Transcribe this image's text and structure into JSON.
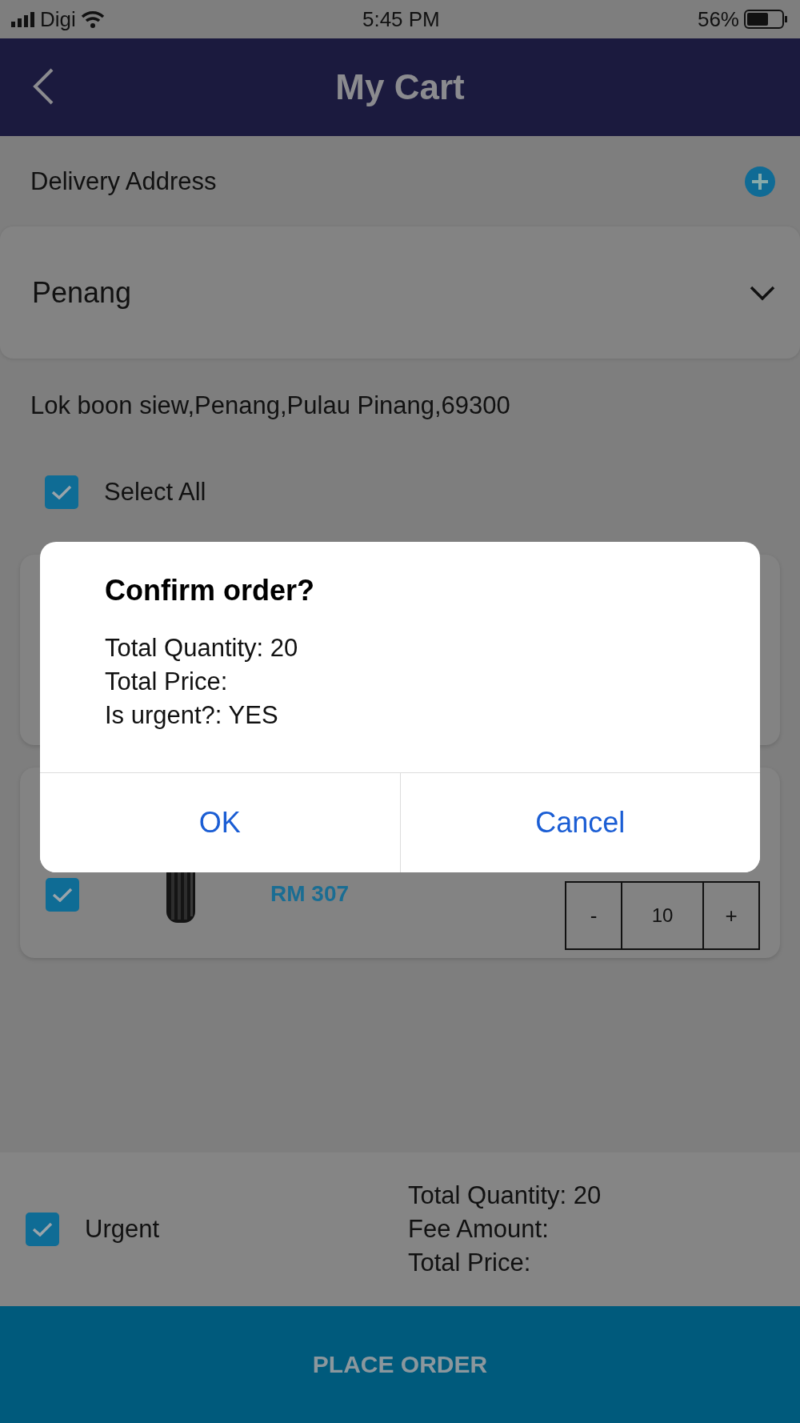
{
  "status_bar": {
    "carrier": "Digi",
    "time": "5:45 PM",
    "battery": "56%"
  },
  "header": {
    "title": "My Cart"
  },
  "delivery": {
    "label": "Delivery Address",
    "location": "Penang",
    "address": "Lok boon siew,Penang,Pulau Pinang,69300"
  },
  "select_all": {
    "label": "Select All",
    "checked": true
  },
  "cart_items": [
    {
      "kind": "covered"
    },
    {
      "kind": "product",
      "checked": true,
      "price": "RM 307",
      "decrease": "-",
      "quantity": "10",
      "increase": "+"
    }
  ],
  "footer": {
    "urgent": {
      "label": "Urgent",
      "checked": true
    },
    "totals": [
      "Total Quantity: 20",
      "Fee Amount:",
      "Total Price:"
    ],
    "button": "PLACE ORDER"
  },
  "dialog": {
    "title": "Confirm order?",
    "lines": [
      "Total Quantity: 20",
      "Total Price:",
      "Is urgent?: YES"
    ],
    "buttons": [
      {
        "label": "OK"
      },
      {
        "label": "Cancel"
      }
    ]
  }
}
